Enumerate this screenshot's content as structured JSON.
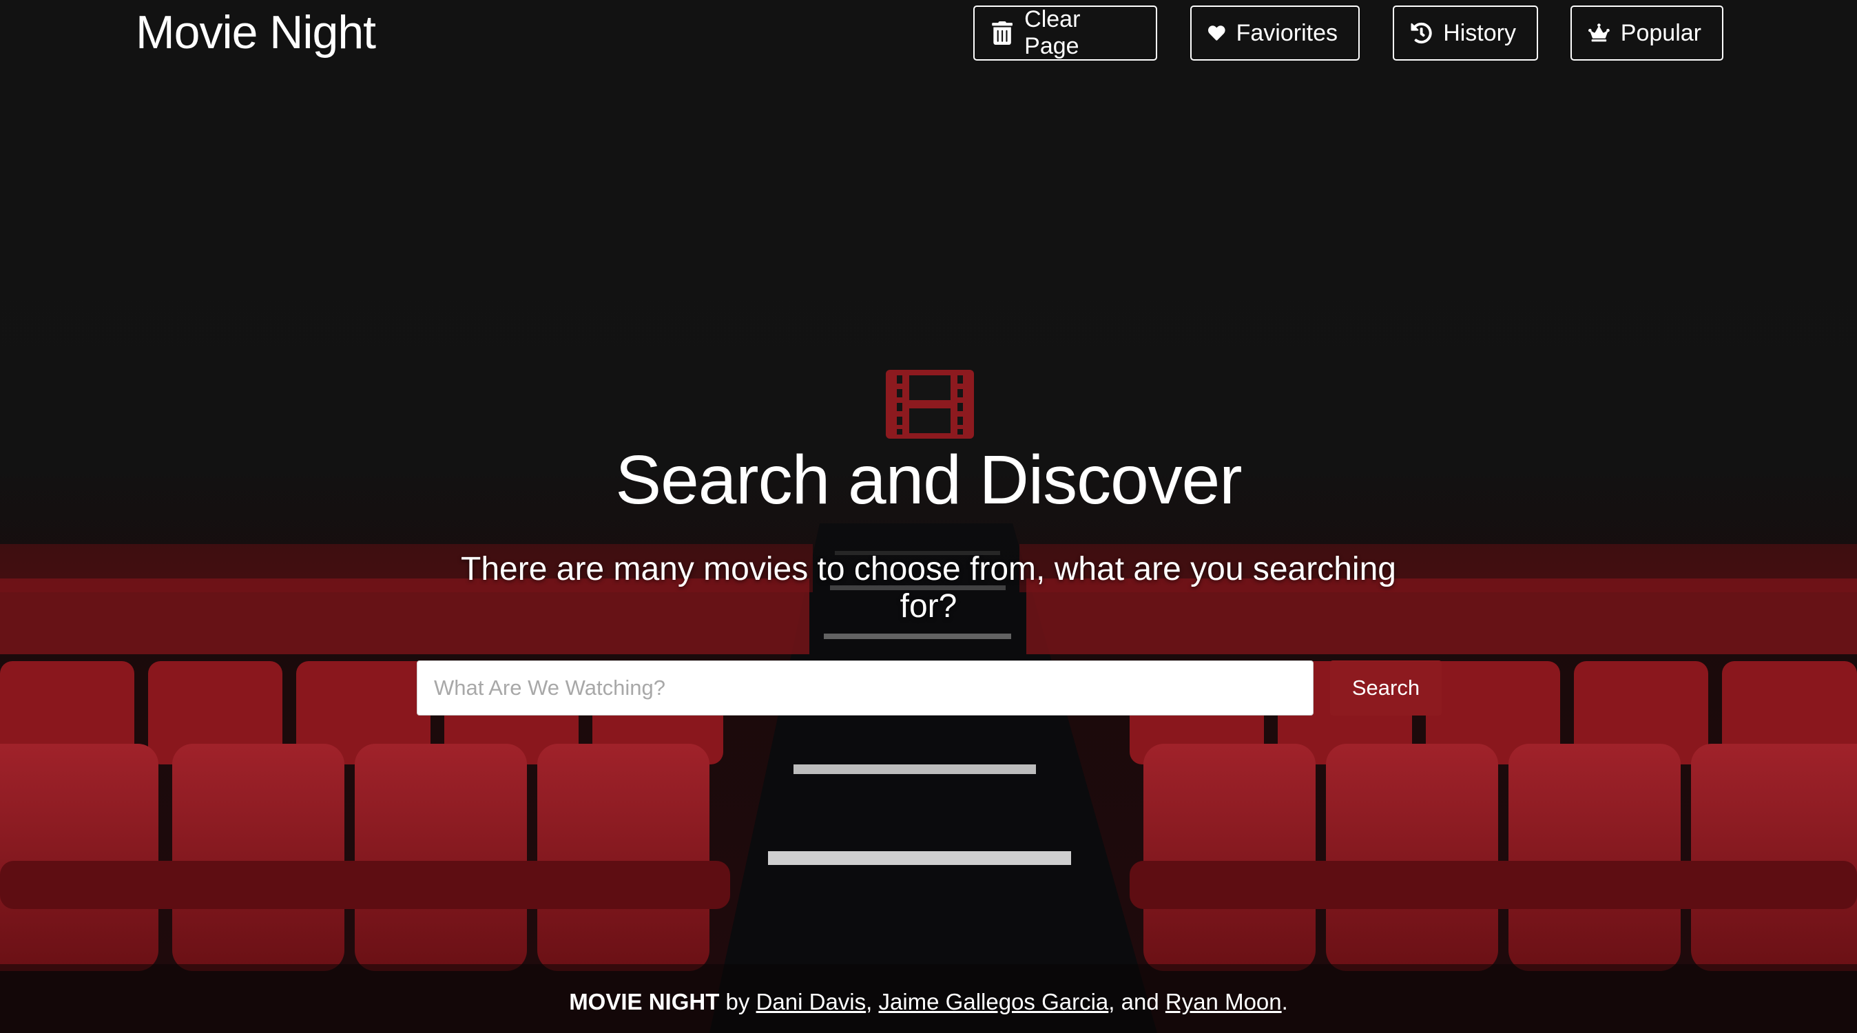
{
  "header": {
    "brand": "Movie Night",
    "nav": {
      "clear": "Clear Page",
      "favorites": "Faviorites",
      "history": "History",
      "popular": "Popular"
    }
  },
  "hero": {
    "icon": "film-icon",
    "title": "Search and Discover",
    "subtitle": "There are many movies to choose from, what are you searching for?"
  },
  "search": {
    "placeholder": "What Are We Watching?",
    "value": "",
    "button_label": "Search"
  },
  "footer": {
    "brand": "MOVIE NIGHT",
    "by": " by ",
    "author1": "Dani Davis",
    "sep1": ", ",
    "author2": "Jaime Gallegos Garcia",
    "sep2": ", and ",
    "author3": "Ryan Moon",
    "end": "."
  },
  "colors": {
    "accent": "#8d1a1f",
    "seat": "#8b1a1e",
    "background": "#121212"
  }
}
